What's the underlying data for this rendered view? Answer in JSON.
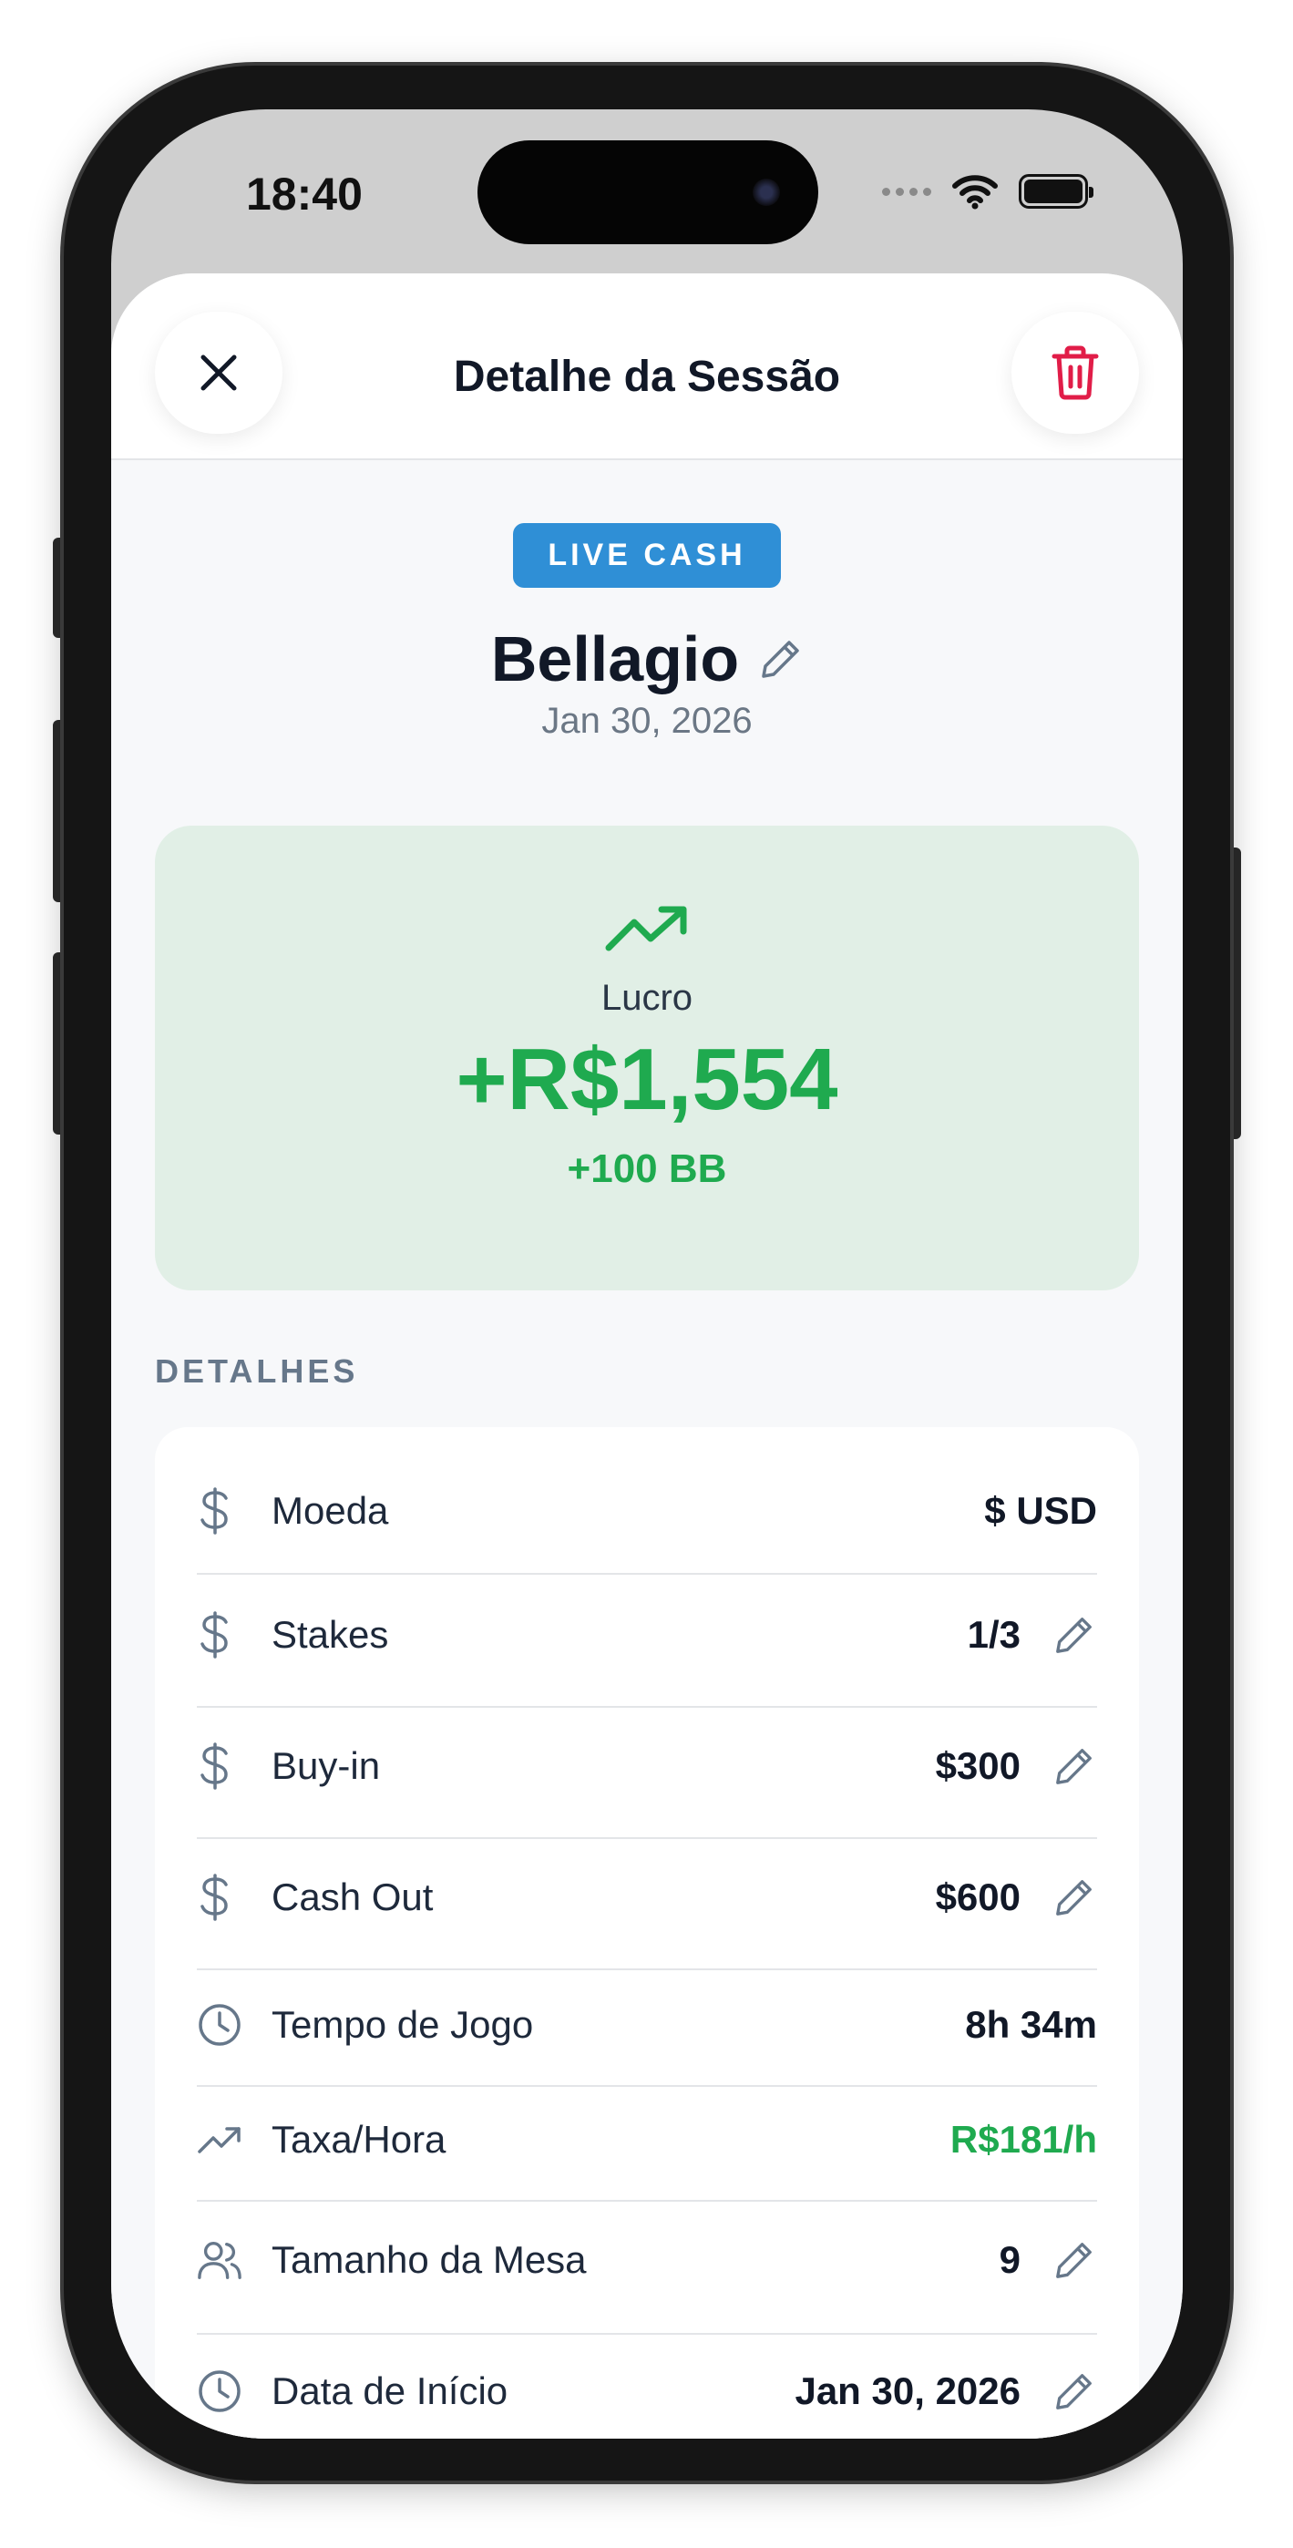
{
  "status_bar": {
    "time": "18:40"
  },
  "nav": {
    "title": "Detalhe da Sessão",
    "close_icon": "close-icon",
    "delete_icon": "trash-icon"
  },
  "session": {
    "type_badge": "LIVE CASH",
    "venue": "Bellagio",
    "date": "Jan 30, 2026"
  },
  "profit": {
    "label": "Lucro",
    "amount": "+R$1,554",
    "bb": "+100 BB",
    "color": "#1faa4f"
  },
  "details": {
    "section_title": "DETALHES",
    "rows": [
      {
        "icon": "dollar-icon",
        "label": "Moeda",
        "value": "$ USD",
        "editable": false
      },
      {
        "icon": "dollar-icon",
        "label": "Stakes",
        "value": "1/3",
        "editable": true
      },
      {
        "icon": "dollar-icon",
        "label": "Buy-in",
        "value": "$300",
        "editable": true
      },
      {
        "icon": "dollar-icon",
        "label": "Cash Out",
        "value": "$600",
        "editable": true
      },
      {
        "icon": "clock-icon",
        "label": "Tempo de Jogo",
        "value": "8h 34m",
        "editable": false
      },
      {
        "icon": "trending-up-icon",
        "label": "Taxa/Hora",
        "value": "R$181/h",
        "editable": false
      },
      {
        "icon": "users-icon",
        "label": "Tamanho da Mesa",
        "value": "9",
        "editable": true
      },
      {
        "icon": "clock-icon",
        "label": "Data de Início",
        "value": "Jan 30, 2026",
        "editable": true
      }
    ]
  },
  "colors": {
    "accent_blue": "#2f8fd6",
    "danger": "#e11d48",
    "positive": "#1faa4f",
    "icon_gray": "#66778a"
  }
}
